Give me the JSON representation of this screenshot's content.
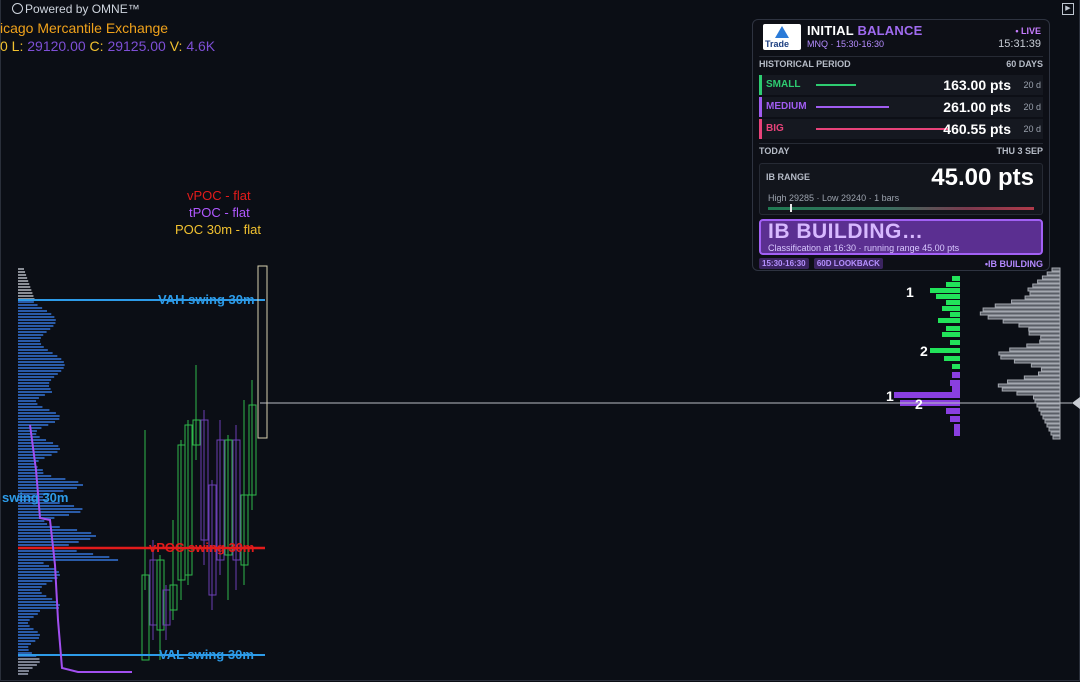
{
  "header": {
    "powered_by": "Powered by OMNE™",
    "exchange": "icago Mercantile Exchange",
    "ohlc": [
      {
        "key": "0 L:",
        "value": "29120.00"
      },
      {
        "key": "C:",
        "value": "29125.00"
      },
      {
        "key": "V:",
        "value": "4.6K"
      }
    ]
  },
  "poc_legend": {
    "vpoc": "vPOC  - flat",
    "tpoc": "tPOC  - flat",
    "poc30": "POC 30m  - flat"
  },
  "chart_labels": {
    "vah": "VAH swing 30m",
    "val": "VAL swing 30m",
    "vpoc": "vPOC swing 30m",
    "swing": "swing 30m",
    "marker_1_top": "1",
    "marker_2_top": "2",
    "marker_1_low": "1",
    "marker_2_low": "2"
  },
  "colors": {
    "vah": "#2d9be8",
    "val": "#2d9be8",
    "vpoc": "#e21b1b",
    "tpoc": "#a24ff0",
    "poc30": "#f2c230",
    "profile_blue": "#2a5ba8",
    "profile_grey": "#8a8e96",
    "bull": "#2fb84a",
    "bear": "#6b3fb3",
    "ib_green": "#22e35a",
    "ib_purple": "#8a3fe0"
  },
  "ib_panel": {
    "title_a": "INITIAL",
    "title_b": "BALANCE",
    "logo_text": "Trade",
    "symbol_line": "MNQ  ·  15:30-16:30",
    "live": "• LIVE",
    "time": "15:31:39",
    "historical_label": "HISTORICAL PERIOD",
    "historical_days": "60 DAYS",
    "rows": [
      {
        "label": "SMALL",
        "value": "163.00 pts",
        "days": "20 d",
        "color": "#2ecc71",
        "level": 0.3
      },
      {
        "label": "MEDIUM",
        "value": "261.00 pts",
        "days": "20 d",
        "color": "#a05cf0",
        "level": 0.55
      },
      {
        "label": "BIG",
        "value": "460.55 pts",
        "days": "20 d",
        "color": "#e8437a",
        "level": 1.0
      }
    ],
    "today_label": "TODAY",
    "today_date": "THU 3 SEP",
    "range_label": "IB RANGE",
    "range_value": "45.00 pts",
    "range_detail": "High 29285   ·   Low 29240   ·   1 bars",
    "building_title": "IB BUILDING…",
    "building_sub": "Classification at 16:30   ·   running range 45.00 pts",
    "footer_chips": [
      "15:30-16:30",
      "60D LOOKBACK"
    ],
    "footer_status": "•IB BUILDING"
  },
  "corner_button": "▶"
}
